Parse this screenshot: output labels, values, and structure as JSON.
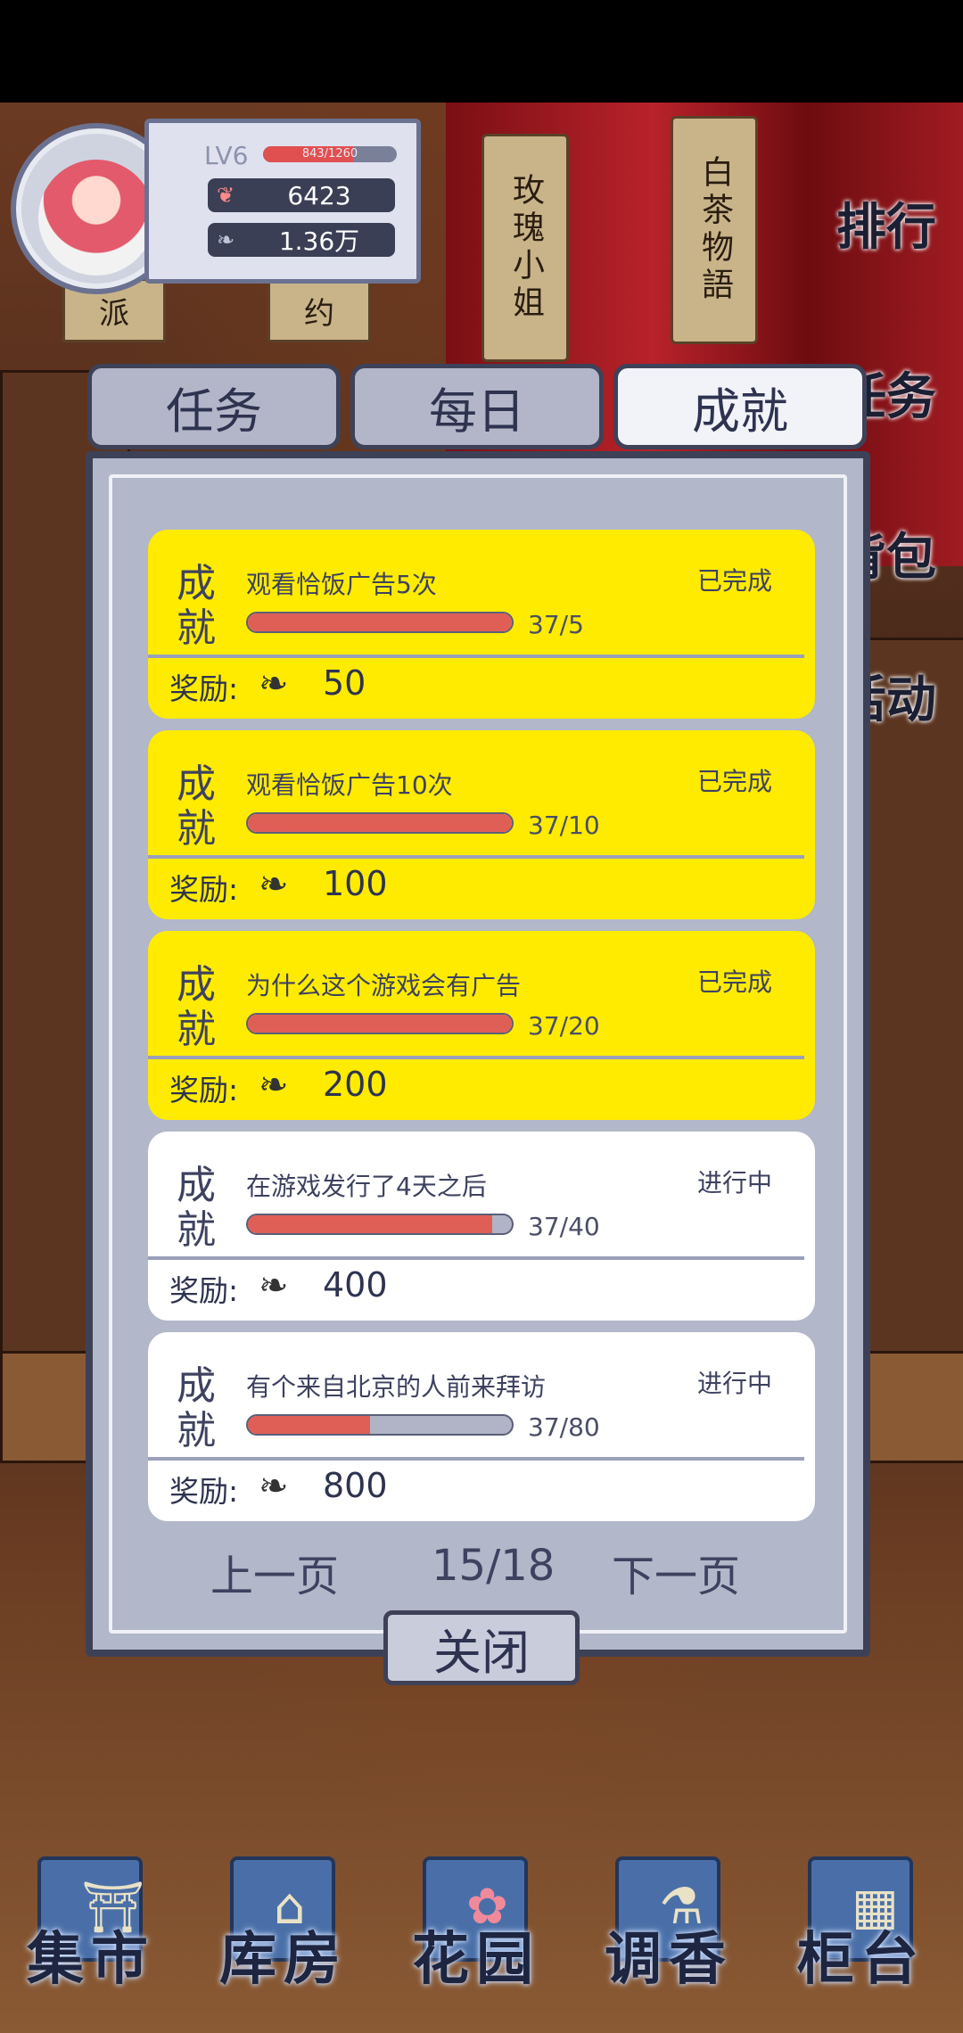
{
  "player": {
    "level": "LV6",
    "xp_text": "843/1260",
    "xp_fraction": 0.67,
    "petals": "6423",
    "leaves": "1.36万"
  },
  "hanging_plaques": [
    "玫瑰小姐",
    "白茶物語"
  ],
  "side_menu": [
    "排行",
    "任务",
    "背包",
    "活动"
  ],
  "tabs": [
    {
      "label": "任务",
      "active": false
    },
    {
      "label": "每日",
      "active": false
    },
    {
      "label": "成就",
      "active": true
    }
  ],
  "reward_label": "奖励:",
  "card_badge": "成就",
  "achievements": [
    {
      "title": "观看恰饭广告5次",
      "status": "已完成",
      "progress": "37/5",
      "fraction": 1.0,
      "reward": "50",
      "done": true
    },
    {
      "title": "观看恰饭广告10次",
      "status": "已完成",
      "progress": "37/10",
      "fraction": 1.0,
      "reward": "100",
      "done": true
    },
    {
      "title": "为什么这个游戏会有广告",
      "status": "已完成",
      "progress": "37/20",
      "fraction": 1.0,
      "reward": "200",
      "done": true
    },
    {
      "title": "在游戏发行了4天之后",
      "status": "进行中",
      "progress": "37/40",
      "fraction": 0.925,
      "reward": "400",
      "done": false
    },
    {
      "title": "有个来自北京的人前来拜访",
      "status": "进行中",
      "progress": "37/80",
      "fraction": 0.4625,
      "reward": "800",
      "done": false
    }
  ],
  "pager": {
    "prev": "上一页",
    "page": "15/18",
    "next": "下一页"
  },
  "close_label": "关闭",
  "bottom_nav": [
    "集市",
    "库房",
    "花园",
    "调香",
    "柜台"
  ]
}
